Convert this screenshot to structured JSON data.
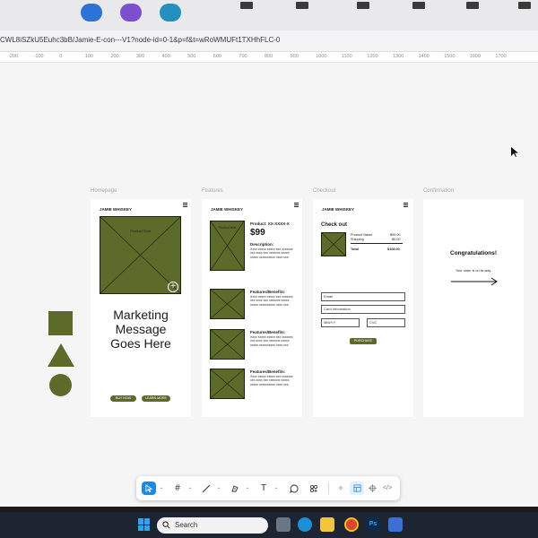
{
  "browser": {
    "url": "CWL8iSZkU5Euhc3bB/Jamie-E-con---V1?node-id=0-1&p=f&t=wRoWMUFt1TXHhFLC-0"
  },
  "ruler": {
    "ticks": [
      "-200",
      "-100",
      "0",
      "100",
      "200",
      "300",
      "400",
      "500",
      "600",
      "700",
      "800",
      "900",
      "1000",
      "1100",
      "1200",
      "1300",
      "1400",
      "1500",
      "1600",
      "1700"
    ]
  },
  "frames": {
    "homepage": {
      "label": "Homepage",
      "logo": "JAMIE WHISKEY",
      "product_label": "Product Shot",
      "headline": "Marketing Message Goes Here",
      "buy_button": "BUY NOW",
      "learn_button": "LEARN MORE"
    },
    "features": {
      "label": "Features",
      "logo": "JAMIE WHISKEY",
      "product_label": "Product shot",
      "product_name": "Product: XX-XXXX-X",
      "price": "$99",
      "description_title": "Description:",
      "description_text": "Xxxx xxxxx xxxxx xxx xxxxxxx xxx xxxx xxx xxxxxxx xxxxx xxxxx xxxxxxxxxx xxxx xxx.",
      "benefit_title": "Features/Benefits:",
      "benefit_text": "Xxxx xxxxx xxxxx xxx xxxxxxx xxx xxxx xxx xxxxxxx xxxxx xxxxx xxxxxxxxxx xxxx xxx."
    },
    "checkout": {
      "label": "Checkout",
      "logo": "JAMIE WHISKEY",
      "title": "Check out",
      "line_product": "Product Name",
      "line_product_price": "$99.00",
      "line_shipping": "Shipping",
      "line_shipping_price": "$0.00",
      "line_total": "Total",
      "line_total_price": "$108.00",
      "email_placeholder": "Email",
      "card_placeholder": "Card Information",
      "date_placeholder": "MM/YY",
      "cvc_placeholder": "CVC",
      "purchase_button": "PURCHASE"
    },
    "confirmation": {
      "label": "Confirmation",
      "title": "Congratulations!",
      "message": "Your order is on its way."
    }
  },
  "taskbar": {
    "search_placeholder": "Search",
    "ps_label": "Ps"
  },
  "colors": {
    "accent": "#5d6a2a",
    "selected_tool": "#1e88e5"
  }
}
